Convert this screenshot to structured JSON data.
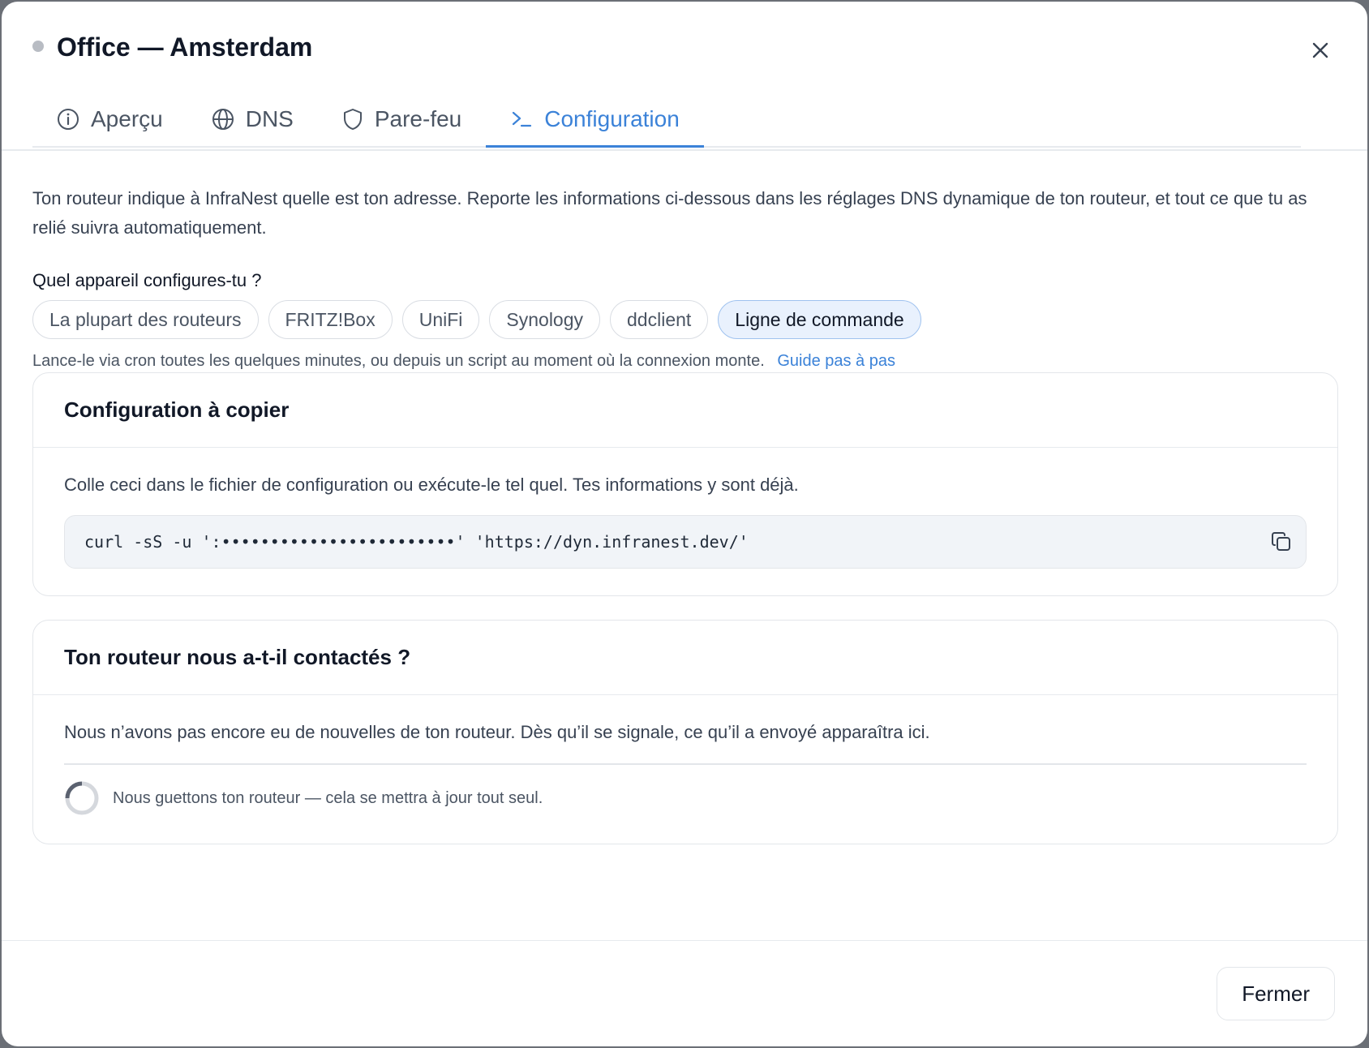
{
  "header": {
    "title": "Office — Amsterdam",
    "status_dot_color": "#b8bcc3"
  },
  "tabs": [
    {
      "label": "Aperçu",
      "icon": "info-icon",
      "active": false
    },
    {
      "label": "DNS",
      "icon": "globe-icon",
      "active": false
    },
    {
      "label": "Pare-feu",
      "icon": "shield-icon",
      "active": false
    },
    {
      "label": "Configuration",
      "icon": "terminal-icon",
      "active": true
    }
  ],
  "intro": "Ton routeur indique à InfraNest quelle est ton adresse. Reporte les informations ci-dessous dans les réglages DNS dynamique de ton routeur, et tout ce que tu as relié suivra automatiquement.",
  "device_picker": {
    "label": "Quel appareil configures-tu ?",
    "options": [
      "La plupart des routeurs",
      "FRITZ!Box",
      "UniFi",
      "Synology",
      "ddclient",
      "Ligne de commande"
    ],
    "selected": "Ligne de commande"
  },
  "hint": {
    "text": "Lance-le via cron toutes les quelques minutes, ou depuis un script au moment où la connexion monte.",
    "link": "Guide pas à pas"
  },
  "config_card": {
    "title": "Configuration à copier",
    "description": "Colle ceci dans le fichier de configuration ou exécute-le tel quel. Tes informations y sont déjà.",
    "code": "curl -sS -u ':••••••••••••••••••••••••' 'https://dyn.infranest.dev/'",
    "copy_icon": "copy-icon"
  },
  "status_card": {
    "title": "Ton routeur nous a-t-il contactés ?",
    "description": "Nous n’avons pas encore eu de nouvelles de ton routeur. Dès qu’il se signale, ce qu’il a envoyé apparaîtra ici.",
    "waiting_text": "Nous guettons ton routeur — cela se mettra à jour tout seul."
  },
  "footer": {
    "close_label": "Fermer"
  },
  "colors": {
    "accent": "#3b82d8",
    "chip_selected_bg": "#e9f1fd"
  }
}
